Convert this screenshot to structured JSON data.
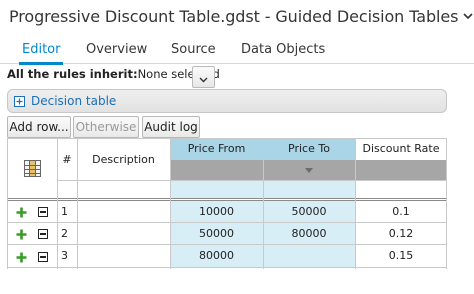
{
  "header": {
    "title": "Progressive Discount Table.gdst - Guided Decision Tables",
    "chevron_icon": "chevron-down-icon"
  },
  "tabs": [
    {
      "label": "Editor",
      "active": true
    },
    {
      "label": "Overview",
      "active": false
    },
    {
      "label": "Source",
      "active": false
    },
    {
      "label": "Data Objects",
      "active": false
    }
  ],
  "inherit": {
    "label": "All the rules inherit:",
    "value": "None selected"
  },
  "decision_table": {
    "label": "Decision table"
  },
  "toolbar": {
    "add_row": "Add row...",
    "otherwise": "Otherwise",
    "audit_log": "Audit log"
  },
  "grid": {
    "columns": {
      "number": "#",
      "description": "Description",
      "price_from": "Price From",
      "price_to": "Price To",
      "discount_rate": "Discount Rate"
    },
    "rows": [
      {
        "num": "1",
        "description": "",
        "price_from": "10000",
        "price_to": "50000",
        "discount_rate": "0.1"
      },
      {
        "num": "2",
        "description": "",
        "price_from": "50000",
        "price_to": "80000",
        "discount_rate": "0.12"
      },
      {
        "num": "3",
        "description": "",
        "price_from": "80000",
        "price_to": "",
        "discount_rate": "0.15"
      }
    ]
  },
  "colors": {
    "accent": "#0088ce",
    "header_blue": "#a9d5e6",
    "selected_column": "#d8eef7",
    "add_icon": "#3a9a2a"
  }
}
